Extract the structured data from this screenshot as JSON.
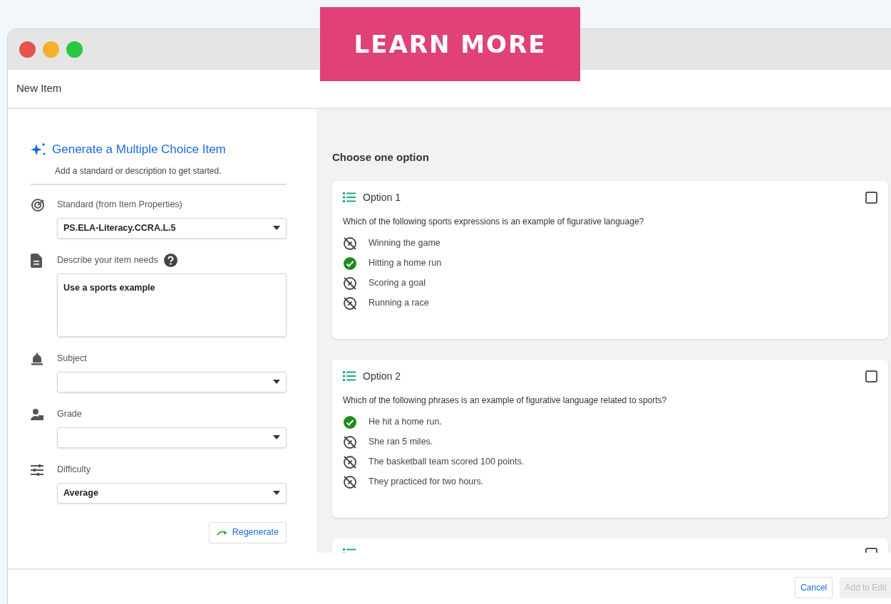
{
  "promo_button": "LEARN MORE",
  "window": {
    "title": "New Item"
  },
  "generator": {
    "title": "Generate a Multiple Choice Item",
    "subtitle": "Add a standard or description to get started.",
    "fields": [
      {
        "kind": "select",
        "label": "Standard (from Item Properties)",
        "value": "PS.ELA-Literacy.CCRA.L.5",
        "help": false
      },
      {
        "kind": "textarea",
        "label": "Describe your item needs",
        "value": "Use a sports example",
        "help": true
      },
      {
        "kind": "select",
        "label": "Subject",
        "help": false
      },
      {
        "kind": "select",
        "label": "Grade",
        "help": false
      },
      {
        "kind": "select",
        "label": "Difficulty",
        "value": "Average",
        "help": false
      }
    ],
    "regenerate_button": "Regenerate"
  },
  "options_panel": {
    "title": "Choose one option",
    "options": [
      {
        "title": "Option 1",
        "checked": false,
        "question": "Which of the following sports expressions is an example of figurative language?",
        "answers": [
          {
            "text": "Winning the game",
            "correct": false
          },
          {
            "text": "Hitting a home run",
            "correct": true
          },
          {
            "text": "Scoring a goal",
            "correct": false
          },
          {
            "text": "Running a race",
            "correct": false
          }
        ]
      },
      {
        "title": "Option 2",
        "checked": false,
        "question": "Which of the following phrases is an example of figurative language related to sports?",
        "answers": [
          {
            "text": "He hit a home run.",
            "correct": true
          },
          {
            "text": "She ran 5 miles.",
            "correct": false
          },
          {
            "text": "The basketball team scored 100 points.",
            "correct": false
          },
          {
            "text": "They practiced for two hours.",
            "correct": false
          }
        ]
      },
      {
        "checked": false
      }
    ]
  },
  "footer": {
    "buttons": [
      {
        "label": "Cancel",
        "disabled": false
      },
      {
        "label": "Add to Edit",
        "disabled": true
      }
    ]
  }
}
